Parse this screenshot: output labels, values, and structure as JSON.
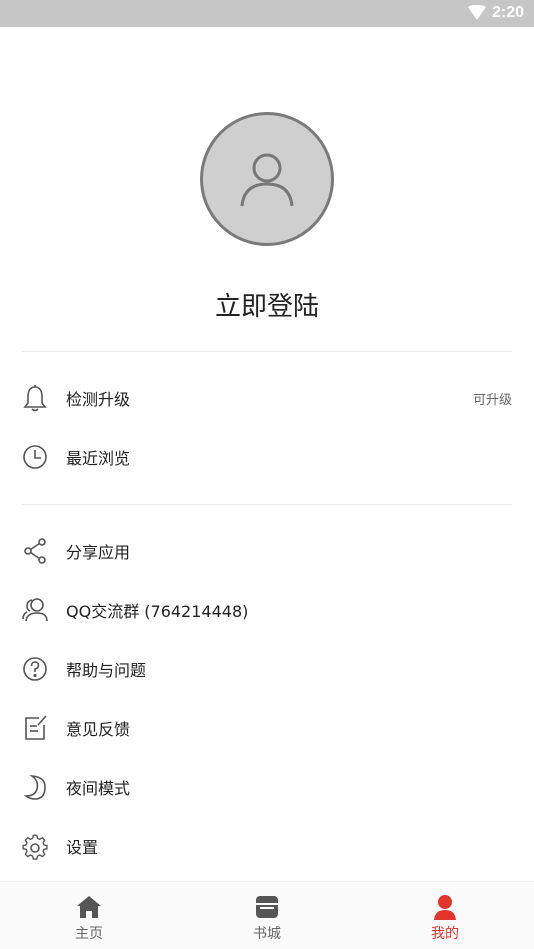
{
  "status_bar": {
    "time": "2:20"
  },
  "profile": {
    "login_label": "立即登陆"
  },
  "menu": {
    "group1": [
      {
        "label": "检测升级",
        "extra": "可升级",
        "icon": "bell-icon"
      },
      {
        "label": "最近浏览",
        "icon": "clock-icon"
      }
    ],
    "group2": [
      {
        "label": "分享应用",
        "icon": "share-icon"
      },
      {
        "label": "QQ交流群 (764214448)",
        "icon": "users-icon"
      },
      {
        "label": "帮助与问题",
        "icon": "help-icon"
      },
      {
        "label": "意见反馈",
        "icon": "feedback-icon"
      },
      {
        "label": "夜间模式",
        "icon": "moon-icon"
      },
      {
        "label": "设置",
        "icon": "gear-icon"
      }
    ]
  },
  "tabs": [
    {
      "label": "主页",
      "icon": "home-icon"
    },
    {
      "label": "书城",
      "icon": "store-icon"
    },
    {
      "label": "我的",
      "icon": "person-icon",
      "active": true
    }
  ],
  "colors": {
    "accent": "#e2362c",
    "status_bar": "#c6c6c6",
    "icon_gray": "#555555"
  }
}
